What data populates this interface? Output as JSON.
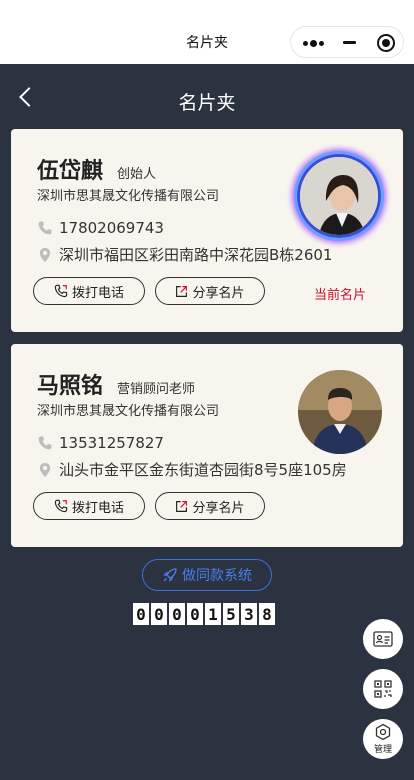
{
  "wechat": {
    "title": "名片夹"
  },
  "nav": {
    "title": "名片夹"
  },
  "cards": [
    {
      "name": "伍岱麒",
      "role": "创始人",
      "company": "深圳市思其晟文化传播有限公司",
      "phone": "17802069743",
      "address": "深圳市福田区彩田南路中深花园B栋2601",
      "call_label": "拨打电话",
      "share_label": "分享名片",
      "badge": "当前名片"
    },
    {
      "name": "马照铭",
      "role": "营销顾问老师",
      "company": "深圳市思其晟文化传播有限公司",
      "phone": "13531257827",
      "address": "汕头市金平区金东街道杏园街8号5座105房",
      "call_label": "拨打电话",
      "share_label": "分享名片"
    }
  ],
  "copy_button": {
    "label": "做同款系统"
  },
  "visit_counter": {
    "digits": [
      "0",
      "0",
      "0",
      "0",
      "1",
      "5",
      "3",
      "8"
    ]
  },
  "side_buttons": {
    "manage_label": "管理"
  },
  "colors": {
    "background": "#2b3240",
    "card": "#f8f5ef",
    "accent_red": "#c8102e",
    "accent_blue": "#4a7df0"
  }
}
